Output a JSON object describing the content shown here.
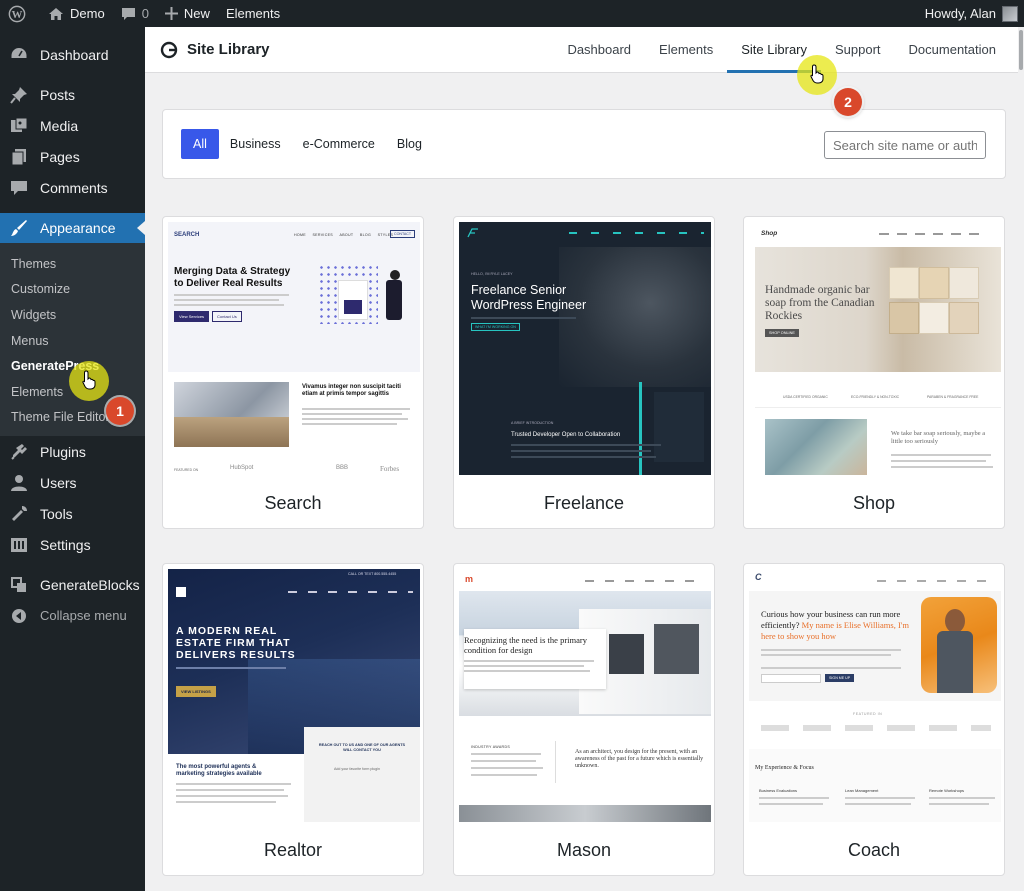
{
  "adminbar": {
    "site_name": "Demo",
    "comments_count": "0",
    "new_label": "New",
    "elements_label": "Elements",
    "howdy": "Howdy, Alan"
  },
  "sidebar": {
    "items": [
      {
        "label": "Dashboard",
        "icon": "dashboard-icon"
      },
      {
        "label": "Posts",
        "icon": "pin-icon"
      },
      {
        "label": "Media",
        "icon": "media-icon"
      },
      {
        "label": "Pages",
        "icon": "pages-icon"
      },
      {
        "label": "Comments",
        "icon": "comment-icon"
      },
      {
        "label": "Appearance",
        "icon": "brush-icon"
      }
    ],
    "appearance_submenu": [
      "Themes",
      "Customize",
      "Widgets",
      "Menus",
      "GeneratePress",
      "Elements",
      "Theme File Editor"
    ],
    "items_after": [
      {
        "label": "Plugins",
        "icon": "plugin-icon"
      },
      {
        "label": "Users",
        "icon": "user-icon"
      },
      {
        "label": "Tools",
        "icon": "wrench-icon"
      },
      {
        "label": "Settings",
        "icon": "settings-icon"
      }
    ],
    "generateblocks": "GenerateBlocks",
    "collapse": "Collapse menu"
  },
  "header": {
    "title": "Site Library",
    "tabs": [
      "Dashboard",
      "Elements",
      "Site Library",
      "Support",
      "Documentation"
    ],
    "active_tab": "Site Library"
  },
  "filters": {
    "categories": [
      "All",
      "Business",
      "e-Commerce",
      "Blog"
    ],
    "active": "All",
    "search_placeholder": "Search site name or autho"
  },
  "sites": [
    {
      "name": "Search",
      "nav": [
        "HOME",
        "SERVICES",
        "ABOUT",
        "BLOG",
        "STYLES",
        "CONTACT"
      ],
      "brand": "SEARCH",
      "headline": "Merging Data & Strategy to Deliver Real Results",
      "btn1": "View Services",
      "btn2": "Contact Us",
      "sub": "Vivamus integer non suscipit taciti etiam at primis tempor sagittis",
      "featured": "FEATURED ON",
      "logos": [
        "HubSpot",
        "BBB",
        "Forbes"
      ]
    },
    {
      "name": "Freelance",
      "hello": "HELLO, I'M RYLE LACEY",
      "headline": "Freelance Senior WordPress Engineer",
      "cta": "WHAT I'M WORKING ON",
      "intro": "A BRIEF INTRODUCTION",
      "sub": "Trusted Developer Open to Collaboration"
    },
    {
      "name": "Shop",
      "brand": "Shop",
      "headline": "Handmade organic bar soap from the Canadian Rockies",
      "cta": "SHOP ONLINE",
      "features": [
        "USDA CERTIFIED ORGANIC",
        "ECO-FRIENDLY & NON-TOXIC",
        "PARABEN & FRAGRANCE FREE"
      ],
      "sub": "We take bar soap seriously, maybe a little too seriously"
    },
    {
      "name": "Realtor",
      "topbar": "CALL OR TEXT 800.555.4455",
      "headline": "A MODERN REAL ESTATE FIRM THAT DELIVERS RESULTS",
      "cta": "VIEW LISTINGS",
      "sub": "The most powerful agents & marketing strategies available",
      "reach": "REACH OUT TO US AND ONE OF OUR AGENTS WILL CONTACT YOU",
      "form": "Add your favorite form plugin"
    },
    {
      "name": "Mason",
      "headline": "Recognizing the need is the primary condition for design",
      "awards": "INDUSTRY AWARDS",
      "quote": "As an architect, you design for the present, with an awareness of the past for a future which is essentially unknown."
    },
    {
      "name": "Coach",
      "brand": "C",
      "headline_a": "Curious how your business can run more efficiently?",
      "headline_b": "My name is Elise Williams, I'm here to show you how",
      "cta": "SIGN ME UP",
      "featured": "FEATURED IN",
      "experience": "My Experience & Focus",
      "focus": [
        "Business Evaluations",
        "Lean Management",
        "Remote Workshops"
      ]
    }
  ],
  "markers": {
    "badge1": "1",
    "badge2": "2"
  },
  "colors": {
    "wp_dark": "#1d2327",
    "wp_blue": "#2271b1",
    "filter_active": "#3858e9",
    "badge": "#d9482b"
  }
}
